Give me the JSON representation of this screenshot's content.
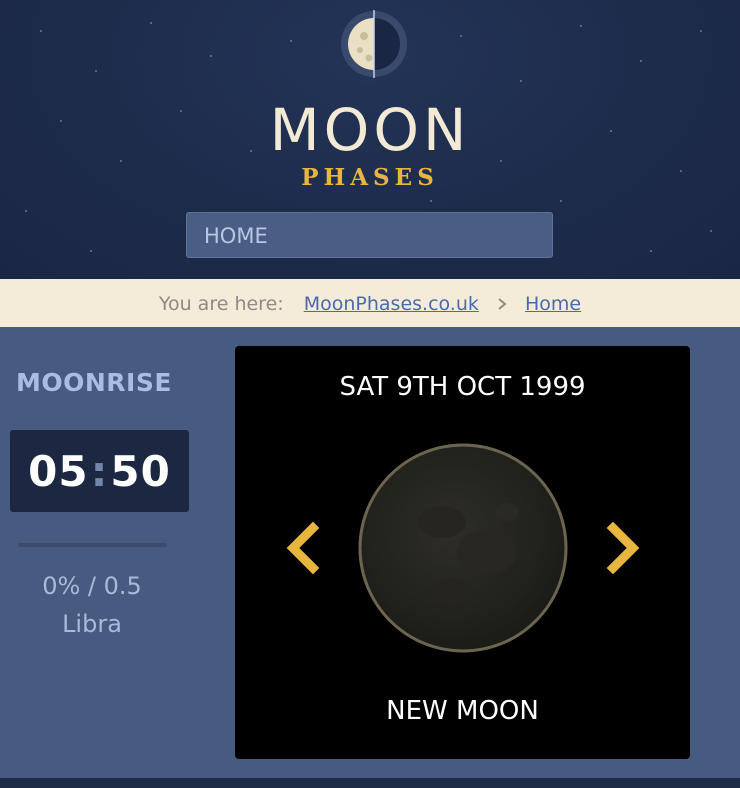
{
  "header": {
    "logo_title": "MOON",
    "logo_subtitle": "PHASES",
    "nav_home_label": "HOME"
  },
  "breadcrumb": {
    "lead": "You are here:",
    "items": [
      "MoonPhases.co.uk",
      "Home"
    ],
    "separator_icon": "chevron-right-icon"
  },
  "moonrise": {
    "title": "MOONRISE",
    "hour": "05",
    "minute": "50",
    "illumination_age": "0% / 0.5",
    "zodiac": "Libra"
  },
  "moon_panel": {
    "date": "SAT 9TH OCT 1999",
    "phase_name": "NEW MOON",
    "prev_icon": "chevron-left-icon",
    "next_icon": "chevron-right-icon"
  },
  "colors": {
    "accent": "#e8b53e",
    "header_bg": "#1d2b4a",
    "body_bg": "#475a80",
    "breadcrumb_bg": "#f5ebd9",
    "link": "#4b6aa8"
  }
}
